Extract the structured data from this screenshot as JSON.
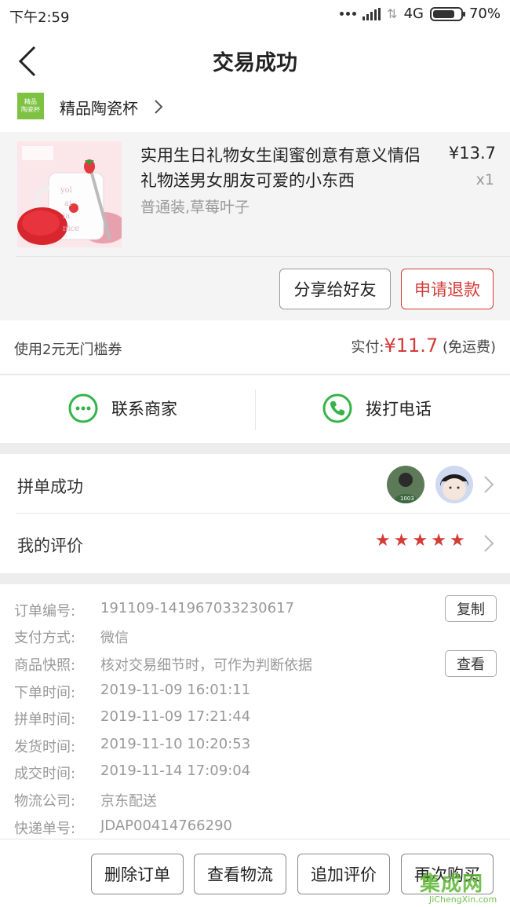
{
  "status_bar": {
    "time": "下午2:59",
    "network": "4G",
    "battery": "70%"
  },
  "header": {
    "title": "交易成功"
  },
  "shop": {
    "name": "精品陶瓷杯",
    "logo_text": "精品\n陶瓷杯"
  },
  "product": {
    "title": "实用生日礼物女生闺蜜创意有意义情侣礼物送男女朋友可爱的小东西",
    "spec": "普通装,草莓叶子",
    "price": "¥13.7",
    "qty": "x1",
    "share_label": "分享给好友",
    "refund_label": "申请退款"
  },
  "payment": {
    "coupon": "使用2元无门槛券",
    "paid_label": "实付:",
    "paid_amount": "¥11.7",
    "shipping": "(免运费)"
  },
  "contact": {
    "merchant_label": "联系商家",
    "call_label": "拨打电话"
  },
  "group": {
    "label": "拼单成功"
  },
  "review": {
    "label": "我的评价",
    "stars": 5
  },
  "details": {
    "rows": [
      {
        "k": "订单编号:",
        "v": "191109-141967033230617"
      },
      {
        "k": "支付方式:",
        "v": "微信"
      },
      {
        "k": "商品快照:",
        "v": "核对交易细节时，可作为判断依据"
      },
      {
        "k": "下单时间:",
        "v": "2019-11-09 16:01:11"
      },
      {
        "k": "拼单时间:",
        "v": "2019-11-09 17:21:44"
      },
      {
        "k": "发货时间:",
        "v": "2019-11-10 10:20:53"
      },
      {
        "k": "成交时间:",
        "v": "2019-11-14 17:09:04"
      },
      {
        "k": "物流公司:",
        "v": "京东配送"
      },
      {
        "k": "快递单号:",
        "v": "JDAP00414766290"
      }
    ],
    "copy_label": "复制",
    "view_label": "查看"
  },
  "bottom": {
    "delete_label": "删除订单",
    "logistics_label": "查看物流",
    "add_review_label": "追加评价",
    "rebuy_label": "再次购买"
  },
  "watermark": {
    "title": "集成网",
    "site": "JiChengXin.com"
  },
  "colors": {
    "accent": "#d43b37",
    "wechat_green": "#35b34a"
  }
}
